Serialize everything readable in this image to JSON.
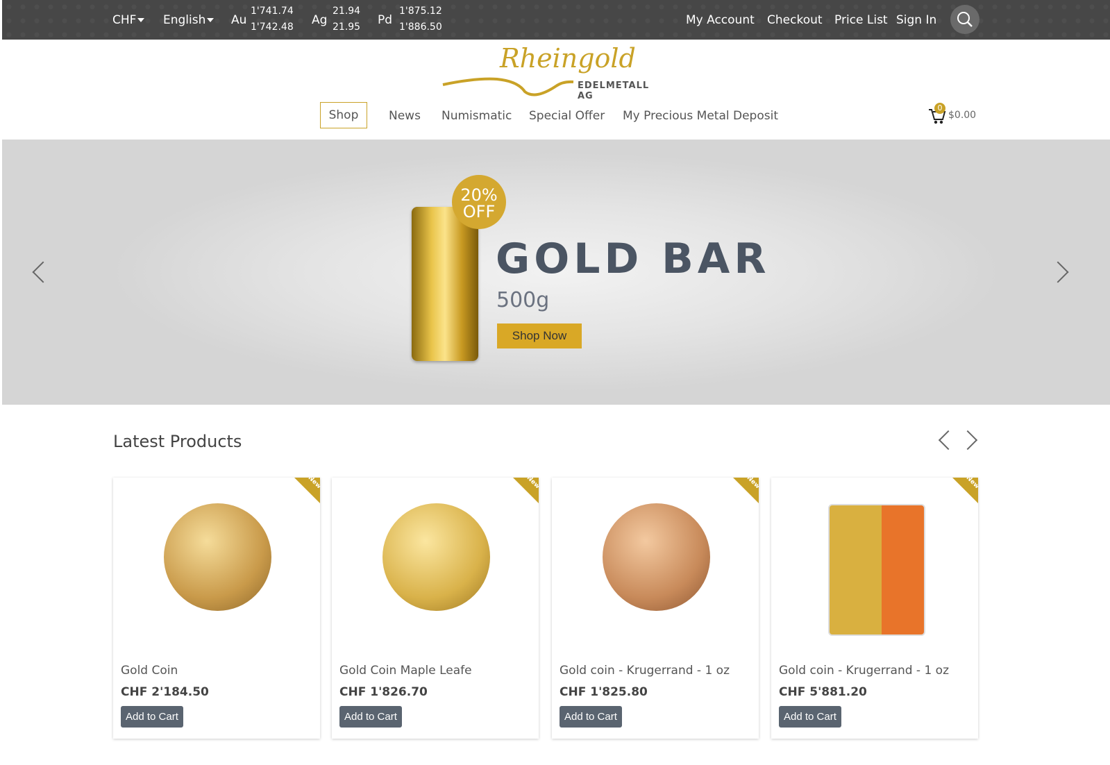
{
  "topbar": {
    "currency": "CHF",
    "language": "English",
    "metals": [
      {
        "symbol": "Au",
        "bid": "1'741.74",
        "ask": "1'742.48"
      },
      {
        "symbol": "Ag",
        "bid": "21.94",
        "ask": "21.95"
      },
      {
        "symbol": "Pd",
        "bid": "1'875.12",
        "ask": "1'886.50"
      }
    ],
    "links": [
      "My Account",
      "Checkout",
      "Price List",
      "Sign In"
    ]
  },
  "logo": {
    "name": "Rheingold",
    "sub": "EDELMETALL AG"
  },
  "nav": [
    "Shop",
    "News",
    "Numismatic",
    "Special Offer",
    "My Precious Metal Deposit"
  ],
  "cart": {
    "count": "0",
    "total": "$0.00"
  },
  "banner": {
    "badge_line1": "20%",
    "badge_line2": "OFF",
    "title": "GOLD BAR",
    "subtitle": "500g",
    "button": "Shop Now"
  },
  "latest": {
    "title": "Latest Products",
    "ribbon": "New",
    "button": "Add to Cart",
    "products": [
      {
        "name": "Gold Coin",
        "price": "CHF 2'184.50"
      },
      {
        "name": "Gold Coin Maple Leafe",
        "price": "CHF 1'826.70"
      },
      {
        "name": "Gold coin - Krugerrand - 1 oz",
        "price": "CHF 1'825.80"
      },
      {
        "name": "Gold coin - Krugerrand - 1 oz",
        "price": "CHF 5'881.20"
      }
    ]
  },
  "colors": {
    "accent": "#c9a227",
    "topbar": "#474747",
    "button": "#5a6470"
  }
}
